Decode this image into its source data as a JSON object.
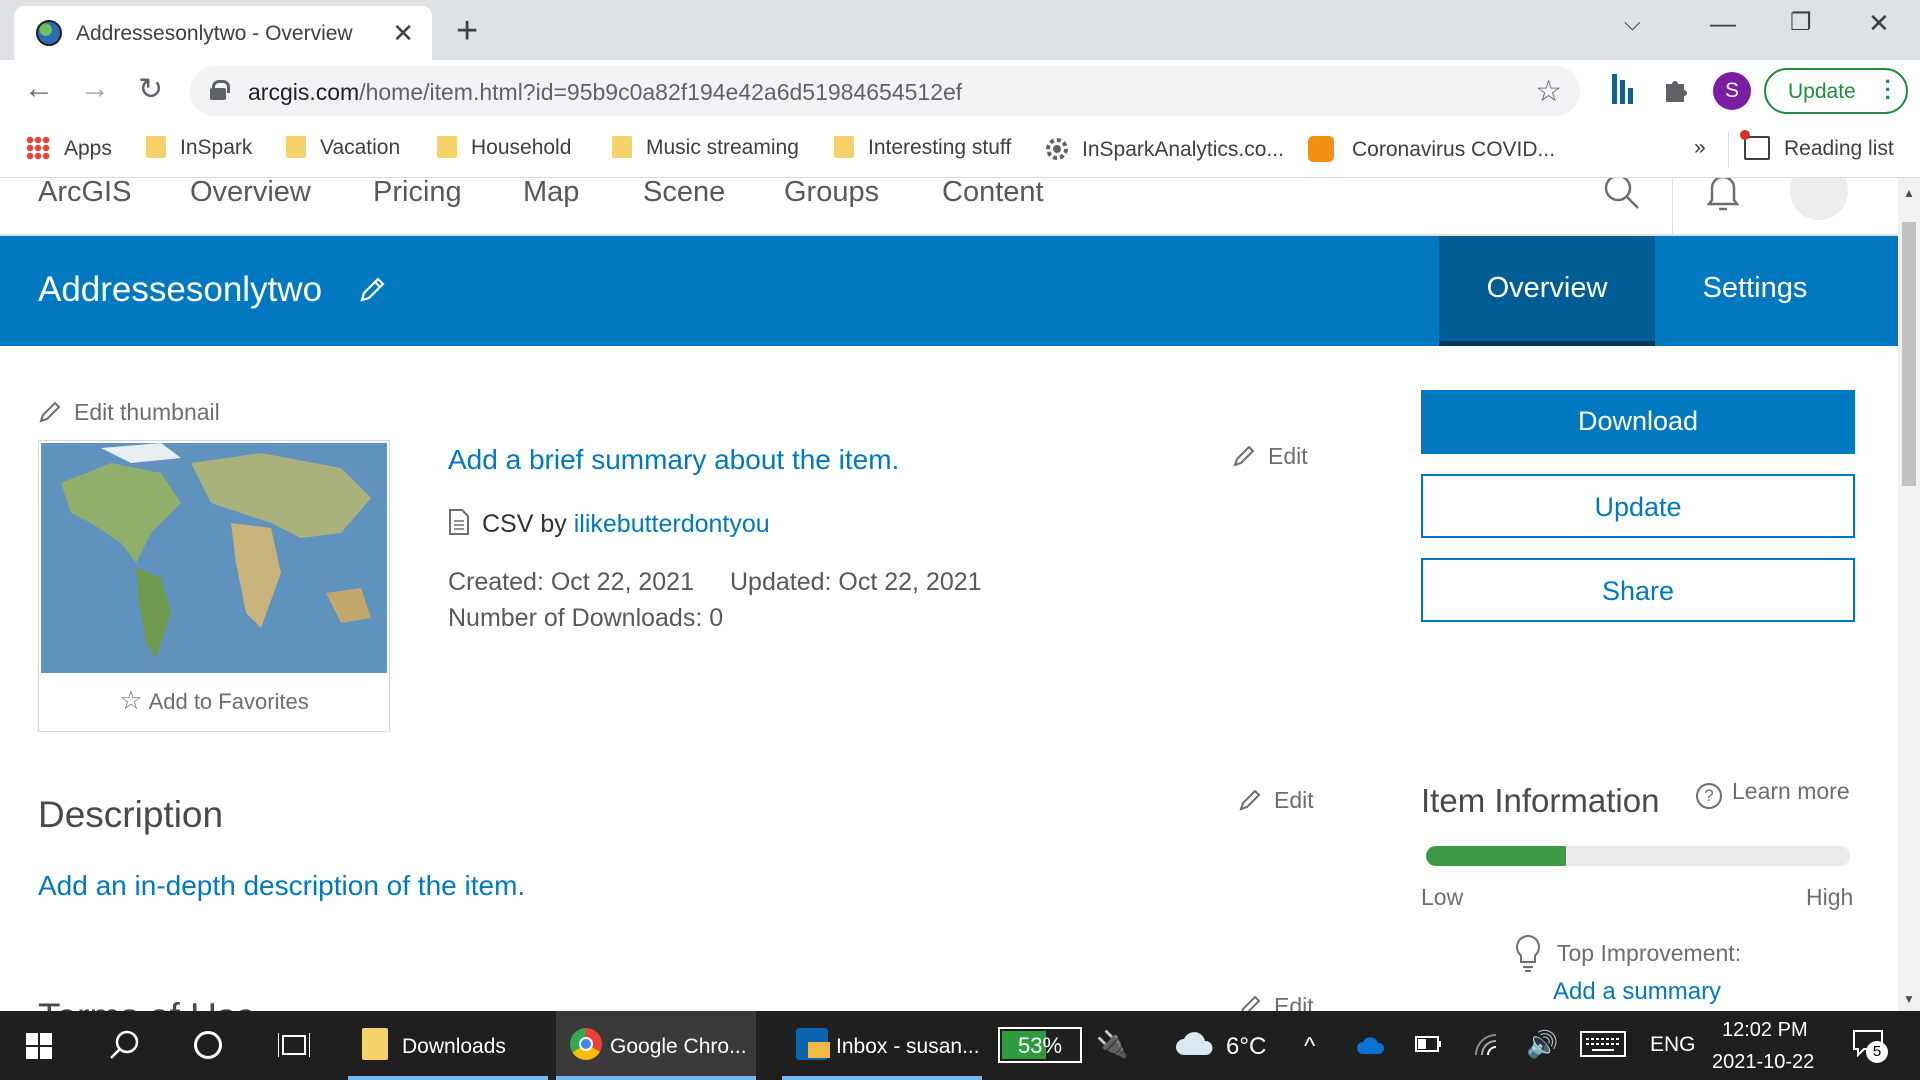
{
  "browser": {
    "tab_title": "Addressesonlytwo - Overview",
    "url_host": "arcgis.com",
    "url_path": "/home/item.html?id=95b9c0a82f194e42a6d51984654512ef",
    "profile_initial": "S",
    "update_label": "Update",
    "bookmarks": [
      {
        "label": "Apps",
        "type": "apps"
      },
      {
        "label": "InSpark",
        "type": "folder"
      },
      {
        "label": "Vacation",
        "type": "folder"
      },
      {
        "label": "Household",
        "type": "folder"
      },
      {
        "label": "Music streaming",
        "type": "folder"
      },
      {
        "label": "Interesting stuff",
        "type": "folder"
      },
      {
        "label": "InSparkAnalytics.co...",
        "type": "site"
      },
      {
        "label": "Coronavirus COVID...",
        "type": "site"
      }
    ],
    "more_bookmarks": "»",
    "reading_list": "Reading list"
  },
  "nav": {
    "items": [
      "ArcGIS",
      "Overview",
      "Pricing",
      "Map",
      "Scene",
      "Groups",
      "Content"
    ]
  },
  "item": {
    "title": "Addressesonlytwo",
    "tabs": [
      "Overview",
      "Settings"
    ],
    "edit_thumbnail": "Edit thumbnail",
    "add_favorites": "Add to Favorites",
    "summary_placeholder": "Add a brief summary about the item.",
    "edit_label": "Edit",
    "type_prefix": "CSV by",
    "owner": "ilikebutterdontyou",
    "created": "Created: Oct 22, 2021",
    "updated": "Updated: Oct 22, 2021",
    "downloads": "Number of Downloads: 0",
    "description_heading": "Description",
    "description_placeholder": "Add an in-depth description of the item.",
    "terms_heading_partial": "Terms of Use"
  },
  "actions": {
    "download": "Download",
    "update": "Update",
    "share": "Share"
  },
  "item_information": {
    "heading": "Item Information",
    "learn_more": "Learn more",
    "low": "Low",
    "high": "High",
    "level": 0.33,
    "top_improvement_label": "Top Improvement:",
    "top_improvement_link": "Add a summary"
  },
  "taskbar": {
    "apps": [
      "Downloads",
      "Google Chro...",
      "Inbox - susan..."
    ],
    "battery": "53%",
    "weather": "6°C",
    "language": "ENG",
    "time": "12:02 PM",
    "date": "2021-10-22",
    "notifications": "5"
  },
  "colors": {
    "brand_blue": "#0079c1",
    "header_active_tab": "#005e95",
    "progress_fill": "#3f9a46"
  }
}
